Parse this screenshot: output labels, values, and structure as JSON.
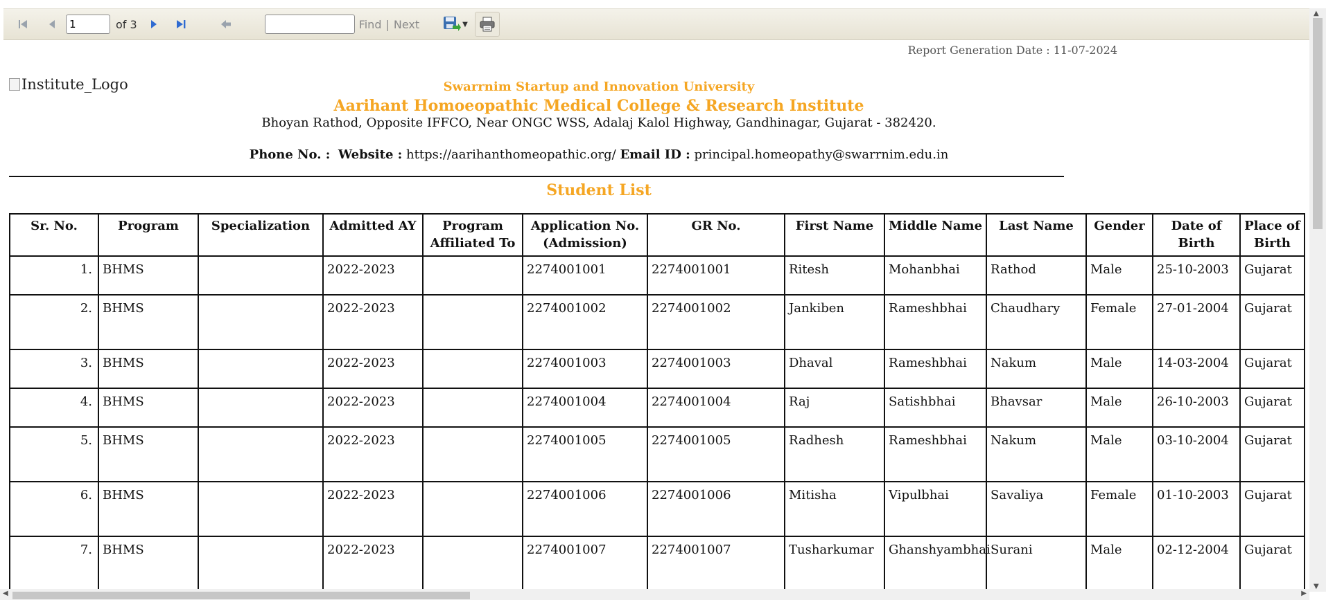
{
  "toolbar": {
    "page_value": "1",
    "of_text": "of 3",
    "find_label": "Find",
    "separator": "|",
    "next_label": "Next"
  },
  "report": {
    "generation_date": "Report Generation Date : 11-07-2024",
    "logo_alt": "Institute_Logo",
    "university": "Swarrnim Startup and Innovation University",
    "college": "Aarihant Homoeopathic Medical College & Research Institute",
    "address": "Bhoyan Rathod, Opposite IFFCO, Near ONGC WSS, Adalaj Kalol Highway, Gandhinagar, Gujarat - 382420.",
    "phone_label": "Phone No. :",
    "website_label": "Website :",
    "website_value": "https://aarihanthomeopathic.org/",
    "email_label": "Email ID :",
    "email_value": "principal.homeopathy@swarrnim.edu.in",
    "list_title": "Student List"
  },
  "table": {
    "columns": [
      "Sr. No.",
      "Program",
      "Specialization",
      "Admitted AY",
      "Program Affiliated To",
      "Application No. (Admission)",
      "GR No.",
      "First Name",
      "Middle Name",
      "Last Name",
      "Gender",
      "Date of Birth",
      "Place of Birth"
    ],
    "rows": [
      {
        "sr": "1.",
        "program": "BHMS",
        "spec": "",
        "ay": "2022-2023",
        "aff": "",
        "app": "2274001001",
        "gr": "2274001001",
        "first": "Ritesh",
        "middle": "Mohanbhai",
        "last": "Rathod",
        "gender": "Male",
        "dob": "25-10-2003",
        "place": "Gujarat"
      },
      {
        "sr": "2.",
        "program": "BHMS",
        "spec": "",
        "ay": "2022-2023",
        "aff": "",
        "app": "2274001002",
        "gr": "2274001002",
        "first": "Jankiben",
        "middle": "Rameshbhai",
        "last": "Chaudhary",
        "gender": "Female",
        "dob": "27-01-2004",
        "place": "Gujarat"
      },
      {
        "sr": "3.",
        "program": "BHMS",
        "spec": "",
        "ay": "2022-2023",
        "aff": "",
        "app": "2274001003",
        "gr": "2274001003",
        "first": "Dhaval",
        "middle": "Rameshbhai",
        "last": "Nakum",
        "gender": "Male",
        "dob": "14-03-2004",
        "place": "Gujarat"
      },
      {
        "sr": "4.",
        "program": "BHMS",
        "spec": "",
        "ay": "2022-2023",
        "aff": "",
        "app": "2274001004",
        "gr": "2274001004",
        "first": "Raj",
        "middle": "Satishbhai",
        "last": "Bhavsar",
        "gender": "Male",
        "dob": "26-10-2003",
        "place": "Gujarat"
      },
      {
        "sr": "5.",
        "program": "BHMS",
        "spec": "",
        "ay": "2022-2023",
        "aff": "",
        "app": "2274001005",
        "gr": "2274001005",
        "first": "Radhesh",
        "middle": "Rameshbhai",
        "last": "Nakum",
        "gender": "Male",
        "dob": "03-10-2004",
        "place": "Gujarat"
      },
      {
        "sr": "6.",
        "program": "BHMS",
        "spec": "",
        "ay": "2022-2023",
        "aff": "",
        "app": "2274001006",
        "gr": "2274001006",
        "first": "Mitisha",
        "middle": "Vipulbhai",
        "last": "Savaliya",
        "gender": "Female",
        "dob": "01-10-2003",
        "place": "Gujarat"
      },
      {
        "sr": "7.",
        "program": "BHMS",
        "spec": "",
        "ay": "2022-2023",
        "aff": "",
        "app": "2274001007",
        "gr": "2274001007",
        "first": "Tusharkumar",
        "middle": "Ghanshyambhai",
        "last": "Surani",
        "gender": "Male",
        "dob": "02-12-2004",
        "place": "Gujarat"
      }
    ]
  },
  "colors": {
    "accent": "#f5a623",
    "nav_icon": "#2f6bd1",
    "nav_disabled": "#9aa3ad"
  },
  "icons": [
    "first-page-icon",
    "previous-page-icon",
    "next-page-icon",
    "last-page-icon",
    "back-icon",
    "export-icon",
    "print-icon"
  ]
}
